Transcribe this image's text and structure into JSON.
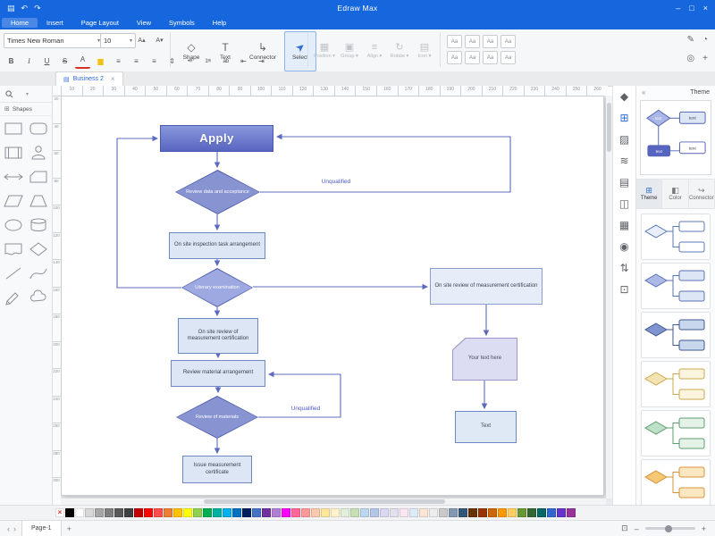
{
  "titlebar": {
    "title": "Edraw Max",
    "left_icons": [
      {
        "name": "save-icon",
        "glyph": "▤"
      },
      {
        "name": "undo-icon",
        "glyph": "↶"
      },
      {
        "name": "redo-icon",
        "glyph": "↷"
      }
    ],
    "window_controls": [
      {
        "name": "minimize-button",
        "glyph": "–"
      },
      {
        "name": "maximize-button",
        "glyph": "□"
      },
      {
        "name": "close-button",
        "glyph": "×"
      }
    ]
  },
  "menubar": {
    "items": [
      {
        "label": "Home",
        "active": true
      },
      {
        "label": "Insert",
        "active": false
      },
      {
        "label": "Page Layout",
        "active": false
      },
      {
        "label": "View",
        "active": false
      },
      {
        "label": "Symbols",
        "active": false
      },
      {
        "label": "Help",
        "active": false
      }
    ]
  },
  "toolbar": {
    "font_family": "Times New Roman",
    "font_size": "10",
    "font_tools": [
      {
        "name": "grow-font-icon",
        "glyph": "A▴"
      },
      {
        "name": "shrink-font-icon",
        "glyph": "A▾"
      }
    ],
    "big_buttons": [
      {
        "name": "shape-button",
        "label": "Shape",
        "glyph": "◇",
        "active": false
      },
      {
        "name": "text-button",
        "label": "Text",
        "glyph": "T",
        "active": false
      },
      {
        "name": "connector-button",
        "label": "Connector",
        "glyph": "↳",
        "active": false
      },
      {
        "name": "select-button",
        "label": "Select",
        "glyph": "➤",
        "active": true
      }
    ],
    "arrange_buttons": [
      {
        "name": "position-button",
        "label": "Position",
        "glyph": "▦"
      },
      {
        "name": "group-button",
        "label": "Group",
        "glyph": "▣"
      },
      {
        "name": "align-button",
        "label": "Align",
        "glyph": "≡"
      },
      {
        "name": "rotate-button",
        "label": "Rotate",
        "glyph": "↻"
      },
      {
        "name": "icon-button",
        "label": "Icon",
        "glyph": "▤"
      }
    ],
    "format_icons": [
      {
        "name": "bold-icon",
        "glyph": "B"
      },
      {
        "name": "italic-icon",
        "glyph": "I"
      },
      {
        "name": "underline-icon",
        "glyph": "U"
      },
      {
        "name": "strikethrough-icon",
        "glyph": "S"
      },
      {
        "name": "font-color-icon",
        "glyph": "A"
      },
      {
        "name": "highlight-icon",
        "glyph": "▆"
      },
      {
        "name": "align-left-icon",
        "glyph": "≡"
      },
      {
        "name": "align-center-icon",
        "glyph": "≡"
      },
      {
        "name": "align-right-icon",
        "glyph": "≡"
      },
      {
        "name": "line-spacing-icon",
        "glyph": "⇕"
      },
      {
        "name": "bullet-list-icon",
        "glyph": "•≡"
      },
      {
        "name": "numbered-list-icon",
        "glyph": "1≡"
      },
      {
        "name": "character-spacing-icon",
        "glyph": "ab"
      },
      {
        "name": "indent-decrease-icon",
        "glyph": "⇤"
      },
      {
        "name": "indent-increase-icon",
        "glyph": "⇥"
      }
    ],
    "style_boxes": [
      {
        "name": "text-style-1",
        "glyph": "Aa"
      },
      {
        "name": "text-style-2",
        "glyph": "Aa"
      },
      {
        "name": "text-style-3",
        "glyph": "Aa"
      },
      {
        "name": "text-style-4",
        "glyph": "Aa"
      },
      {
        "name": "text-style-5",
        "glyph": "Aa"
      },
      {
        "name": "text-style-6",
        "glyph": "Aa"
      },
      {
        "name": "text-style-7",
        "glyph": "Aa"
      },
      {
        "name": "text-style-8",
        "glyph": "Aa"
      }
    ],
    "right_icons_row1": [
      {
        "name": "pen-icon",
        "glyph": "✎"
      },
      {
        "name": "format-painter-icon",
        "glyph": "◔"
      }
    ],
    "right_icons_row2": [
      {
        "name": "find-icon",
        "glyph": "◎"
      },
      {
        "name": "snap-icon",
        "glyph": "+"
      }
    ]
  },
  "tabbar": {
    "doc_icon_glyph": "▤",
    "tabs": [
      {
        "label": "Business 2",
        "active": true,
        "close_glyph": "×"
      }
    ]
  },
  "rulers": {
    "horizontal": [
      10,
      20,
      30,
      40,
      50,
      60,
      70,
      80,
      90,
      100,
      110,
      120,
      130,
      140,
      150,
      160,
      170,
      180,
      190,
      200,
      210,
      220,
      230,
      240,
      250,
      260
    ],
    "vertical": [
      20,
      40,
      60,
      80,
      100,
      120,
      140,
      160,
      180,
      200,
      220,
      240,
      260,
      280,
      300
    ]
  },
  "shapes_panel": {
    "header": "Shapes",
    "shapes": [
      {
        "name": "rectangle-shape",
        "type": "rect"
      },
      {
        "name": "rounded-rectangle-shape",
        "type": "round"
      },
      {
        "name": "predefined-process-shape",
        "type": "process"
      },
      {
        "name": "person-shape",
        "type": "person"
      },
      {
        "name": "double-arrow-shape",
        "type": "arrow"
      },
      {
        "name": "card-shape",
        "type": "card"
      },
      {
        "name": "parallelogram-shape",
        "type": "parallelogram"
      },
      {
        "name": "trapezoid-shape",
        "type": "trapezoid"
      },
      {
        "name": "ellipse-shape",
        "type": "ellipse"
      },
      {
        "name": "cylinder-shape",
        "type": "cylinder"
      },
      {
        "name": "document-shape",
        "type": "document"
      },
      {
        "name": "diamond-shape",
        "type": "diamond"
      },
      {
        "name": "line-shape",
        "type": "line"
      },
      {
        "name": "curve-shape",
        "type": "curve"
      },
      {
        "name": "pencil-shape",
        "type": "pencil"
      },
      {
        "name": "cloud-shape",
        "type": "cloud"
      }
    ]
  },
  "flowchart": {
    "nodes": {
      "apply": "Apply",
      "review_data": "Review data and acceptance",
      "inspection": "On site inspection task arrangement",
      "literary": "Literary examination",
      "review_right": "On site review of measurement certification",
      "review_left": "On site review of measurement certification",
      "material": "Review material arrangement",
      "review_materials": "Review of materials",
      "certificate": "Issue measurement certificate",
      "your_text": "Your text here",
      "text_box": "Text"
    },
    "edge_labels": {
      "unqualified_top": "Unqualified",
      "unqualified_bottom": "Unqualified"
    },
    "colors": {
      "connector": "#5d6bbf",
      "apply_fill_top": "#8997dd",
      "apply_fill_bottom": "#5765c1",
      "diamond_fill": "#8894d2",
      "diamond_light_fill": "#9da9e0",
      "rect_fill": "#dce6f4",
      "rect_border": "#6f88c1",
      "right_rect_fill": "#e7edf8",
      "card_fill": "#dcdcf2"
    }
  },
  "right_strip": {
    "icons": [
      {
        "name": "fill-style-icon",
        "glyph": "◆",
        "active": false
      },
      {
        "name": "symbol-library-icon",
        "glyph": "⊞",
        "active": true
      },
      {
        "name": "picture-icon",
        "glyph": "▨",
        "active": false
      },
      {
        "name": "layers-icon",
        "glyph": "≋",
        "active": false
      },
      {
        "name": "note-icon",
        "glyph": "▤",
        "active": false
      },
      {
        "name": "chart-icon",
        "glyph": "◫",
        "active": false
      },
      {
        "name": "table-icon",
        "glyph": "▦",
        "active": false
      },
      {
        "name": "history-icon",
        "glyph": "◉",
        "active": false
      },
      {
        "name": "swap-icon",
        "glyph": "⇅",
        "active": false
      },
      {
        "name": "fullscreen-icon",
        "glyph": "⊡",
        "active": false
      }
    ]
  },
  "theme_panel": {
    "title": "Theme",
    "collapse_glyph": "«",
    "tabs": [
      {
        "name": "tab-theme",
        "label": "Theme",
        "glyph": "⊞",
        "active": true
      },
      {
        "name": "tab-color",
        "label": "Color",
        "glyph": "◧",
        "active": false
      },
      {
        "name": "tab-connector",
        "label": "Connector",
        "glyph": "↪",
        "active": false
      }
    ],
    "preview_label": "text",
    "themes": [
      {
        "name": "theme-blue-outline",
        "diamond": "#e8eefa",
        "rect": "#ffffff",
        "stroke": "#5b79b5"
      },
      {
        "name": "theme-blue-light",
        "diamond": "#aab9e6",
        "rect": "#dce6f4",
        "stroke": "#5b72b8"
      },
      {
        "name": "theme-blue-bold",
        "diamond": "#7f93cf",
        "rect": "#c8d6ee",
        "stroke": "#41598f"
      },
      {
        "name": "theme-yellow",
        "diamond": "#f4e3b2",
        "rect": "#fbf4de",
        "stroke": "#c9a94e"
      },
      {
        "name": "theme-green",
        "diamond": "#bfe0c8",
        "rect": "#e4f2e8",
        "stroke": "#5d9c6f"
      },
      {
        "name": "theme-orange",
        "diamond": "#f6c875",
        "rect": "#fbe7c2",
        "stroke": "#d49339"
      }
    ]
  },
  "palette": {
    "colors": [
      "none",
      "#000000",
      "#ffffff",
      "#d8d8d8",
      "#a6a6a6",
      "#7f7f7f",
      "#595959",
      "#3f3f3f",
      "#c00000",
      "#ff0000",
      "#ff4b4b",
      "#ed7d31",
      "#ffc000",
      "#ffff00",
      "#92d050",
      "#00b050",
      "#00b0a0",
      "#00b0f0",
      "#0070c0",
      "#002060",
      "#4472c4",
      "#7030a0",
      "#b07fd4",
      "#ff00ff",
      "#ff6699",
      "#ff9999",
      "#f8cbad",
      "#ffe699",
      "#fff2cc",
      "#e2efda",
      "#c6e0b4",
      "#bdd7ee",
      "#b4c6e7",
      "#d9d9f3",
      "#e4dfec",
      "#fbe5f1",
      "#ddebf7",
      "#fce4d6",
      "#ededed",
      "#c9c9c9",
      "#8497b0",
      "#335577",
      "#663300",
      "#993300",
      "#cc6600",
      "#ff9900",
      "#ffcc66",
      "#669933",
      "#336633",
      "#006666",
      "#3366cc",
      "#6633cc",
      "#993399"
    ]
  },
  "statusbar": {
    "prev_glyph": "‹",
    "next_glyph": "›",
    "page_label": "Page-1",
    "add_page_glyph": "+",
    "fit_glyph": "⊡",
    "zoom_out_glyph": "–",
    "zoom_in_glyph": "+"
  }
}
